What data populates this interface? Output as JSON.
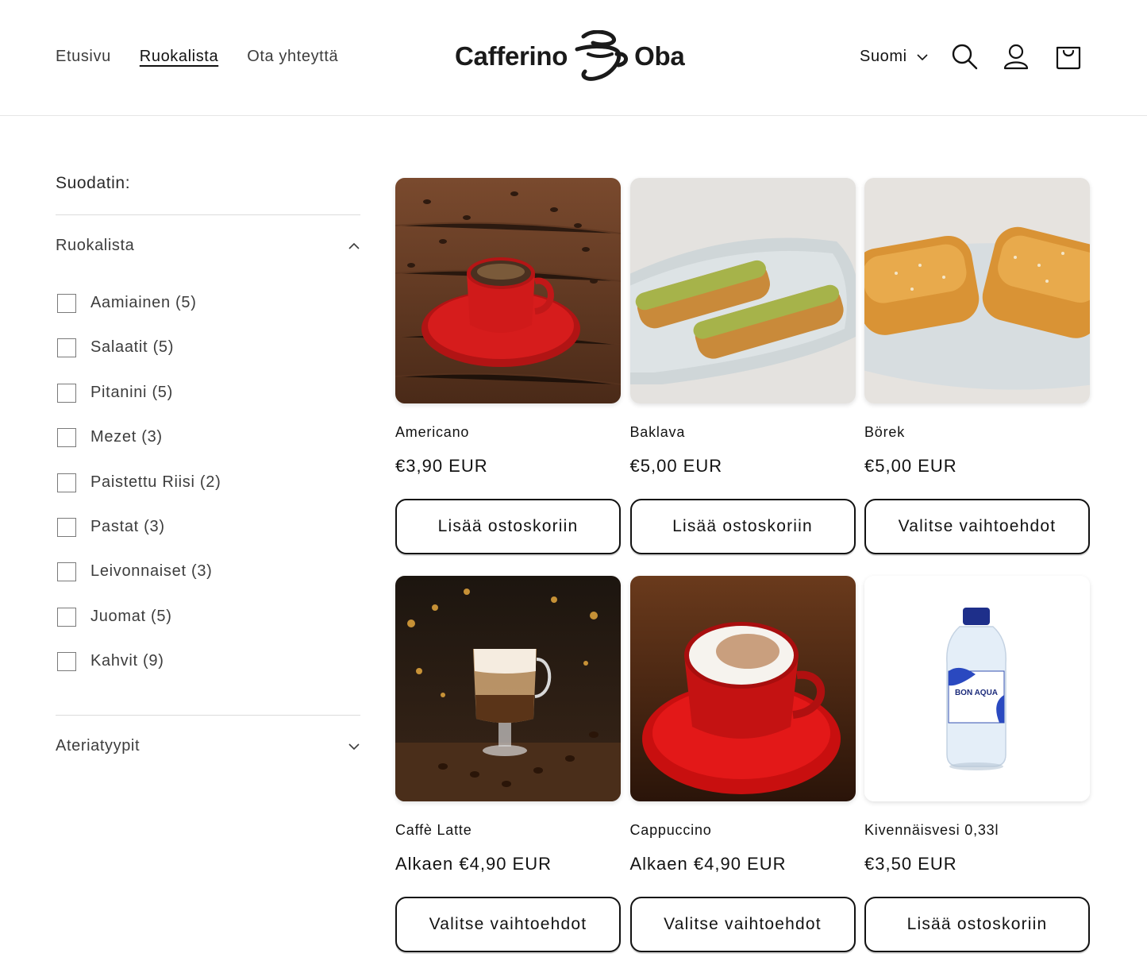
{
  "header": {
    "nav": [
      {
        "label": "Etusivu"
      },
      {
        "label": "Ruokalista"
      },
      {
        "label": "Ota yhteyttä"
      }
    ],
    "logo_left": "Cafferino",
    "logo_right": "Oba",
    "language": "Suomi",
    "icons": [
      "search-icon",
      "account-icon",
      "cart-icon"
    ]
  },
  "sidebar": {
    "title": "Suodatin:",
    "menu_group": {
      "label": "Ruokalista",
      "expanded": true,
      "items": [
        {
          "label": "Aamiainen (5)"
        },
        {
          "label": "Salaatit (5)"
        },
        {
          "label": "Pitanini (5)"
        },
        {
          "label": "Mezet (3)"
        },
        {
          "label": "Paistettu Riisi (2)"
        },
        {
          "label": "Pastat (3)"
        },
        {
          "label": "Leivonnaiset (3)"
        },
        {
          "label": "Juomat (5)"
        },
        {
          "label": "Kahvit (9)"
        }
      ]
    },
    "meal_group": {
      "label": "Ateriatyypit",
      "expanded": false
    }
  },
  "products": [
    {
      "name": "Americano",
      "price": "€3,90 EUR",
      "button": "Lisää ostoskoriin"
    },
    {
      "name": "Baklava",
      "price": "€5,00 EUR",
      "button": "Lisää ostoskoriin"
    },
    {
      "name": "Börek",
      "price": "€5,00 EUR",
      "button": "Valitse vaihtoehdot"
    },
    {
      "name": "Caffè Latte",
      "price": "Alkaen €4,90 EUR",
      "button": "Valitse vaihtoehdot"
    },
    {
      "name": "Cappuccino",
      "price": "Alkaen €4,90 EUR",
      "button": "Valitse vaihtoehdot"
    },
    {
      "name": "Kivennäisvesi 0,33l",
      "price": "€3,50 EUR",
      "button": "Lisää ostoskoriin",
      "bottle_label": "BON AQUA"
    }
  ],
  "colors": {
    "text": "#121212",
    "muted": "#3d3d3d",
    "border": "#dcdcdc",
    "cup_red": "#d01a1a"
  }
}
